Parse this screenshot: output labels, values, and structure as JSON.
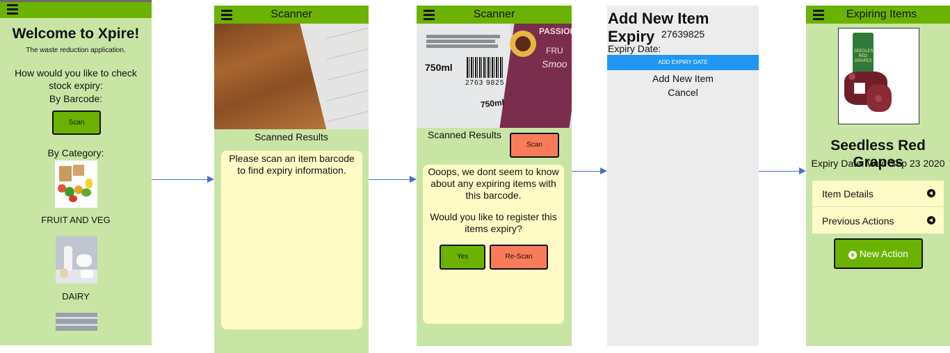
{
  "arrow_color": "#4a72c4",
  "brand_green": "#6bb300",
  "panel_bg": "#c9e5a6",
  "screen1": {
    "title": "Welcome to Xpire!",
    "subtitle": "The waste reduction application.",
    "question": "How would you like to check stock expiry:",
    "by_barcode": "By Barcode:",
    "scan_label": "Scan",
    "by_category": "By Category:",
    "categories": [
      {
        "label": "FRUIT AND VEG",
        "icon": "fruit-veg-image"
      },
      {
        "label": "DAIRY",
        "icon": "dairy-image"
      }
    ]
  },
  "screen2": {
    "bar_title": "Scanner",
    "results_heading": "Scanned Results",
    "message": "Please scan an item barcode to find expiry information."
  },
  "screen3": {
    "bar_title": "Scanner",
    "results_heading": "Scanned Results",
    "scan_label": "Scan",
    "message1": "Ooops, we dont seem to know about any expiring items with this barcode.",
    "message2": "Would you like to register this items expiry?",
    "yes_label": "Yes",
    "rescan_label": "Re-Scan",
    "camera_text": {
      "volume": "750ml",
      "barcode_digits": "2763 9825",
      "brand": "PASSION",
      "fruit": "FRU",
      "smoo": "Smoo"
    }
  },
  "screen4": {
    "title": "Add New Item Expiry",
    "barcode": "27639825",
    "expiry_label": "Expiry Date:",
    "add_expiry_button": "ADD EXPIRY DATE",
    "add_item": "Add New Item",
    "cancel": "Cancel"
  },
  "screen5": {
    "bar_title": "Expiring Items",
    "product_name": "Seedless Red Grapes",
    "expiry": "Expiry Date: Wed Sep 23 2020",
    "accordion": [
      {
        "label": "Item Details"
      },
      {
        "label": "Previous Actions"
      }
    ],
    "new_action": "New Action",
    "pack_text": "SEEDLESS RED GRAPES"
  }
}
